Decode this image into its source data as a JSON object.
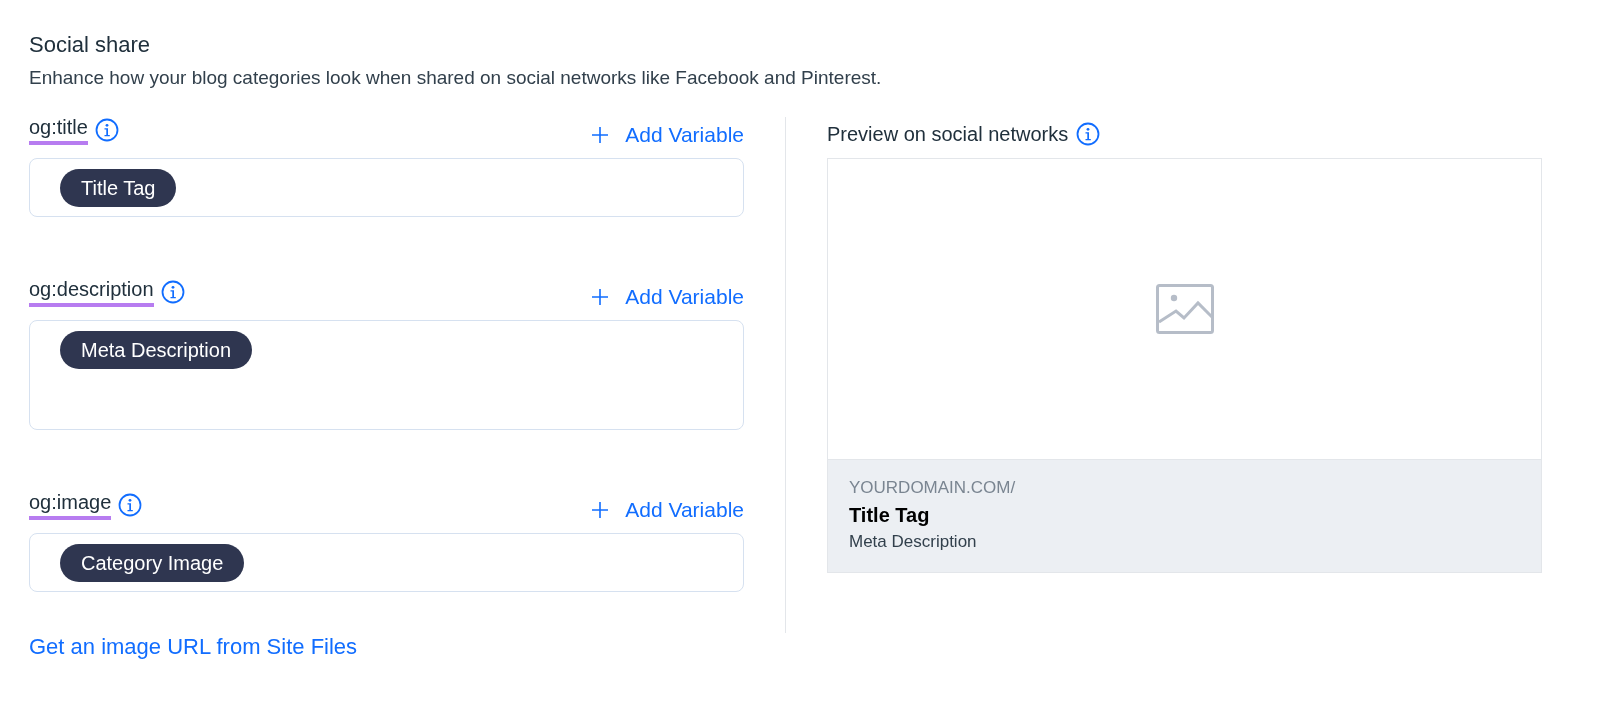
{
  "section": {
    "title": "Social share",
    "description": "Enhance how your blog categories look when shared on social networks like Facebook and Pinterest."
  },
  "fields": [
    {
      "label": "og:title",
      "highlighted": true,
      "add_button": "Add Variable",
      "kind": "single",
      "chip": "Title Tag"
    },
    {
      "label": "og:description",
      "highlighted": true,
      "add_button": "Add Variable",
      "kind": "multi",
      "chip": "Meta Description"
    },
    {
      "label": "og:image",
      "highlighted": true,
      "add_button": "Add Variable",
      "kind": "single",
      "chip": "Category Image"
    }
  ],
  "link": "Get an image URL from Site Files",
  "preview": {
    "title": "Preview on social networks",
    "domain": "YOURDOMAIN.COM/",
    "card_title": "Title Tag",
    "card_description": "Meta Description"
  }
}
